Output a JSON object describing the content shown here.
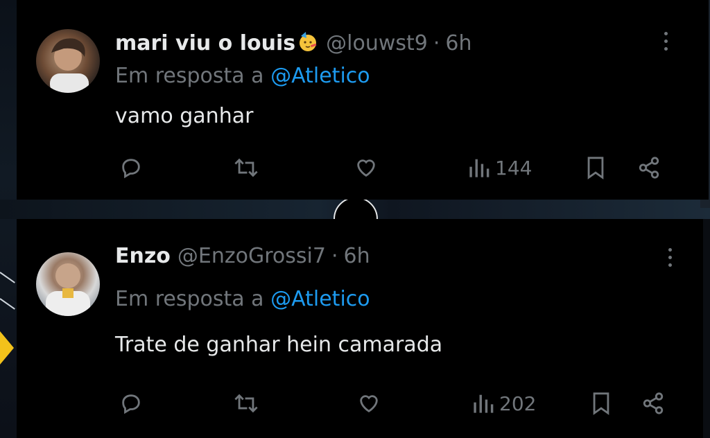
{
  "tweets": [
    {
      "name": "mari viu o louis",
      "name_emoji": "partying-face-emoji",
      "handle": "@louwst9",
      "separator": "·",
      "time": "6h",
      "reply_prefix": "Em resposta a",
      "reply_to": "@Atletico",
      "text": "vamo ganhar",
      "views": "144"
    },
    {
      "name": "Enzo",
      "handle": "@EnzoGrossi7",
      "separator": "·",
      "time": "6h",
      "reply_prefix": "Em resposta a",
      "reply_to": "@Atletico",
      "text": "Trate de ganhar hein camarada",
      "views": "202"
    }
  ],
  "icons": [
    "reply-icon",
    "retweet-icon",
    "like-icon",
    "views-icon",
    "bookmark-icon",
    "share-icon",
    "more-icon"
  ],
  "colors": {
    "background": "#000000",
    "text_primary": "#e7e9ea",
    "text_secondary": "#71767b",
    "mention": "#1d9bf0"
  }
}
